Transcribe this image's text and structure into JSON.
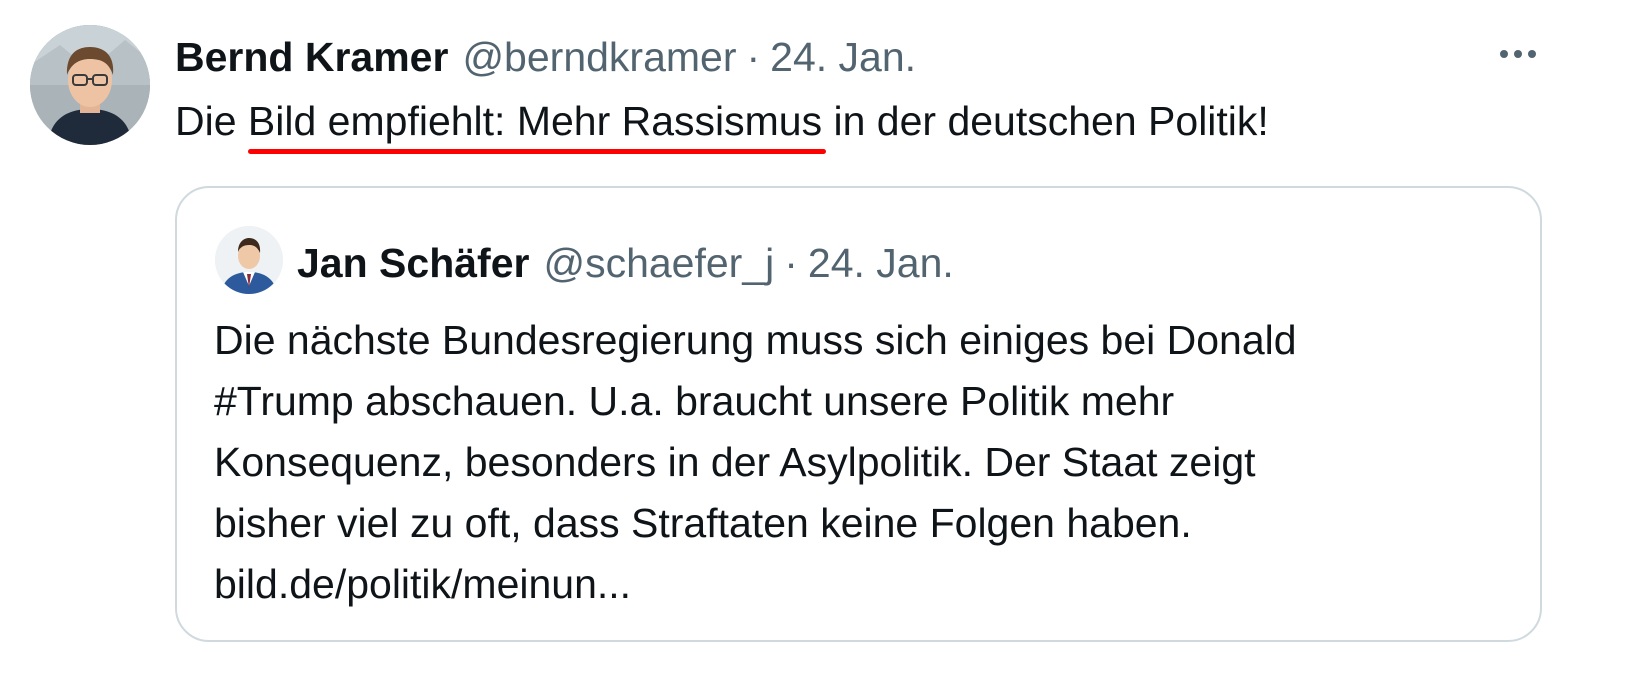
{
  "tweet": {
    "author_name": "Bernd Kramer",
    "author_handle": "@berndkramer",
    "separator": "·",
    "date": "24. Jan.",
    "text_before": "Die ",
    "text_highlight": "Bild empfiehlt: Mehr Rassismus",
    "text_after": " in der deutschen Politik!",
    "highlight_color": "#ff0000",
    "more_icon": "more-horizontal-icon"
  },
  "quoted_tweet": {
    "author_name": "Jan Schäfer",
    "author_handle": "@schaefer_j",
    "separator": "·",
    "date": "24. Jan.",
    "lines": [
      "Die nächste Bundesregierung muss sich einiges bei Donald",
      "#Trump abschauen. U.a. braucht unsere Politik mehr",
      "Konsequenz, besonders in der Asylpolitik. Der Staat zeigt",
      "bisher viel zu oft, dass Straftaten keine Folgen haben.",
      "bild.de/politik/meinun..."
    ]
  },
  "colors": {
    "text_primary": "#0f1419",
    "text_secondary": "#536471",
    "card_border": "#cfd9de"
  }
}
